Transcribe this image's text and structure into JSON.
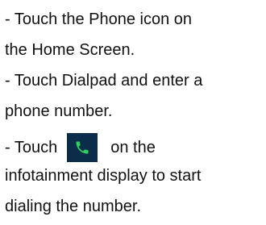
{
  "instructions": {
    "line1": "- Touch the Phone icon on",
    "line2": "the Home Screen.",
    "line3": "- Touch Dialpad and enter a",
    "line4": "phone number.",
    "line5_before": "- Touch",
    "line5_icon": "phone-call-icon",
    "line5_after": "on the",
    "line6": "infotainment display to start",
    "line7": "dialing the number."
  },
  "colors": {
    "icon_background": "#0c2d4a",
    "icon_glyph": "#2bd15a",
    "text": "#111111"
  }
}
